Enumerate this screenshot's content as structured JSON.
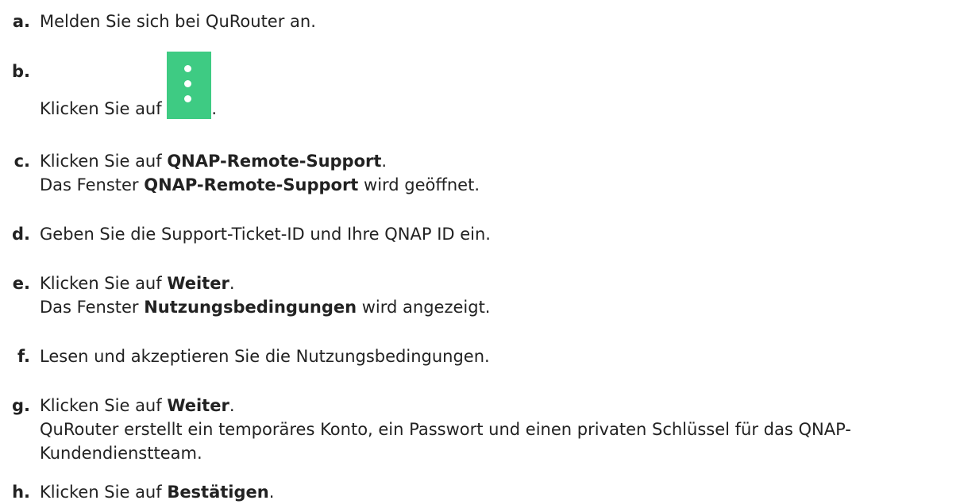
{
  "steps": [
    {
      "marker": "a.",
      "text": "Melden Sie sich bei QuRouter an."
    },
    {
      "marker": "b.",
      "text_before": "Klicken Sie auf ",
      "icon": "kebab-menu-icon",
      "icon_color": "#3ecb83",
      "text_after": "."
    },
    {
      "marker": "c.",
      "line1_prefix": "Klicken Sie auf ",
      "line1_bold": "QNAP-Remote-Support",
      "line1_suffix": ".",
      "line2_prefix": "Das Fenster ",
      "line2_bold": "QNAP-Remote-Support",
      "line2_suffix": " wird geöffnet."
    },
    {
      "marker": "d.",
      "text": "Geben Sie die Support-Ticket-ID und Ihre QNAP ID ein."
    },
    {
      "marker": "e.",
      "line1_prefix": "Klicken Sie auf ",
      "line1_bold": "Weiter",
      "line1_suffix": ".",
      "line2_prefix": "Das Fenster ",
      "line2_bold": "Nutzungsbedingungen",
      "line2_suffix": " wird angezeigt."
    },
    {
      "marker": "f.",
      "text": "Lesen und akzeptieren Sie die Nutzungsbedingungen."
    },
    {
      "marker": "g.",
      "line1_prefix": "Klicken Sie auf ",
      "line1_bold": "Weiter",
      "line1_suffix": ".",
      "line2": "QuRouter erstellt ein temporäres Konto, ein Passwort und einen privaten Schlüssel für das QNAP-",
      "line3": "Kundendienstteam."
    },
    {
      "marker": "h.",
      "line1_prefix": "Klicken Sie auf ",
      "line1_bold": "Bestätigen",
      "line1_suffix": "."
    }
  ]
}
